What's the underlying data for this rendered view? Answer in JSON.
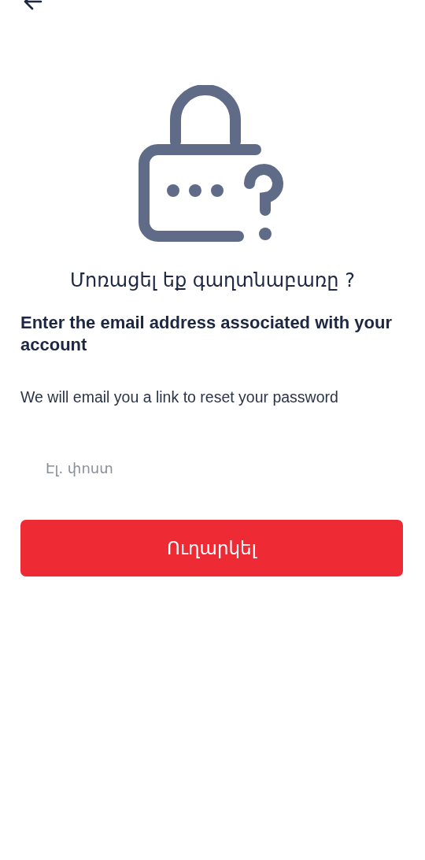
{
  "title": "Մոռացել եք գաղտնաբառը ?",
  "heading": "Enter the email address associated with your account",
  "description": "We will email you a link to reset your password",
  "email_field": {
    "placeholder": "Էլ. փոստ"
  },
  "submit_button": {
    "label": "Ուղարկել"
  }
}
